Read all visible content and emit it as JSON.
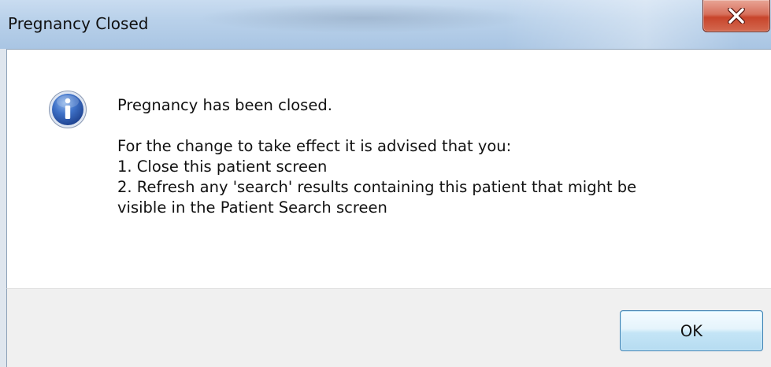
{
  "window": {
    "title": "Pregnancy Closed",
    "close_icon": "close-icon"
  },
  "message": {
    "icon": "info-icon",
    "line1": "Pregnancy has been closed.",
    "line2": "For the change to take effect it is advised that you:",
    "line3": "1. Close this patient screen",
    "line4": "2. Refresh any 'search' results containing this patient that might be",
    "line5": "visible in the Patient Search screen"
  },
  "buttons": {
    "ok_label": "OK"
  },
  "colors": {
    "close_button": "#c8442b",
    "ok_button_border": "#3c7fb1",
    "button_area": "#f0f0f0",
    "content_bg": "#ffffff"
  }
}
